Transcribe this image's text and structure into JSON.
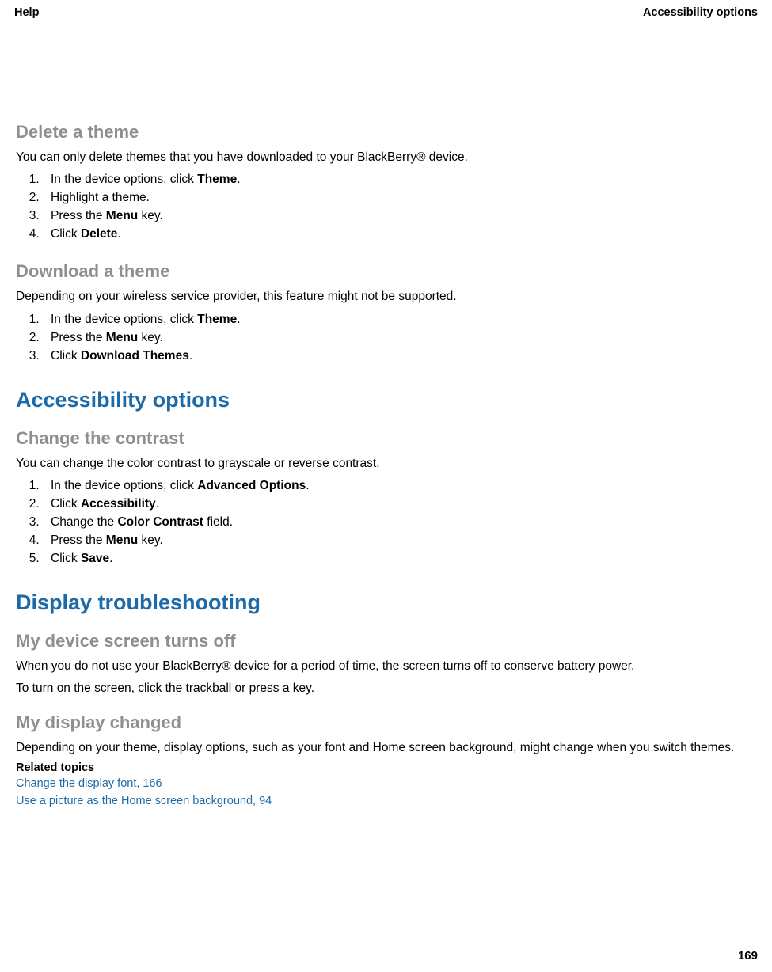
{
  "header": {
    "left": "Help",
    "right": "Accessibility options"
  },
  "sections": {
    "deleteTheme": {
      "title": "Delete a theme",
      "intro": "You can only delete themes that you have downloaded to your BlackBerry® device.",
      "step1_pre": "In the device options, click ",
      "step1_bold": "Theme",
      "step1_post": ".",
      "step2": "Highlight a theme.",
      "step3_pre": "Press the ",
      "step3_bold": "Menu",
      "step3_post": " key.",
      "step4_pre": "Click ",
      "step4_bold": "Delete",
      "step4_post": "."
    },
    "downloadTheme": {
      "title": "Download a theme",
      "intro": "Depending on your wireless service provider, this feature might not be supported.",
      "step1_pre": "In the device options, click ",
      "step1_bold": "Theme",
      "step1_post": ".",
      "step2_pre": "Press the ",
      "step2_bold": "Menu",
      "step2_post": " key.",
      "step3_pre": "Click ",
      "step3_bold": "Download Themes",
      "step3_post": "."
    },
    "accessibility": {
      "title": "Accessibility options"
    },
    "changeContrast": {
      "title": "Change the contrast",
      "intro": "You can change the color contrast to grayscale or reverse contrast.",
      "step1_pre": "In the device options, click ",
      "step1_bold": "Advanced Options",
      "step1_post": ".",
      "step2_pre": "Click ",
      "step2_bold": "Accessibility",
      "step2_post": ".",
      "step3_pre": "Change the ",
      "step3_bold": "Color Contrast",
      "step3_post": " field.",
      "step4_pre": "Press the ",
      "step4_bold": "Menu",
      "step4_post": " key.",
      "step5_pre": "Click ",
      "step5_bold": "Save",
      "step5_post": "."
    },
    "displayTroubleshooting": {
      "title": "Display troubleshooting"
    },
    "screenOff": {
      "title": "My device screen turns off",
      "p1": "When you do not use your BlackBerry® device for a period of time, the screen turns off to conserve battery power.",
      "p2": "To turn on the screen, click the trackball or press a key."
    },
    "displayChanged": {
      "title": "My display changed",
      "p1": "Depending on your theme, display options, such as your font and Home screen background, might change when you switch themes.",
      "relatedHeading": "Related topics",
      "link1": "Change the display font, 166",
      "link2": "Use a picture as the Home screen background, 94"
    }
  },
  "pageNumber": "169"
}
